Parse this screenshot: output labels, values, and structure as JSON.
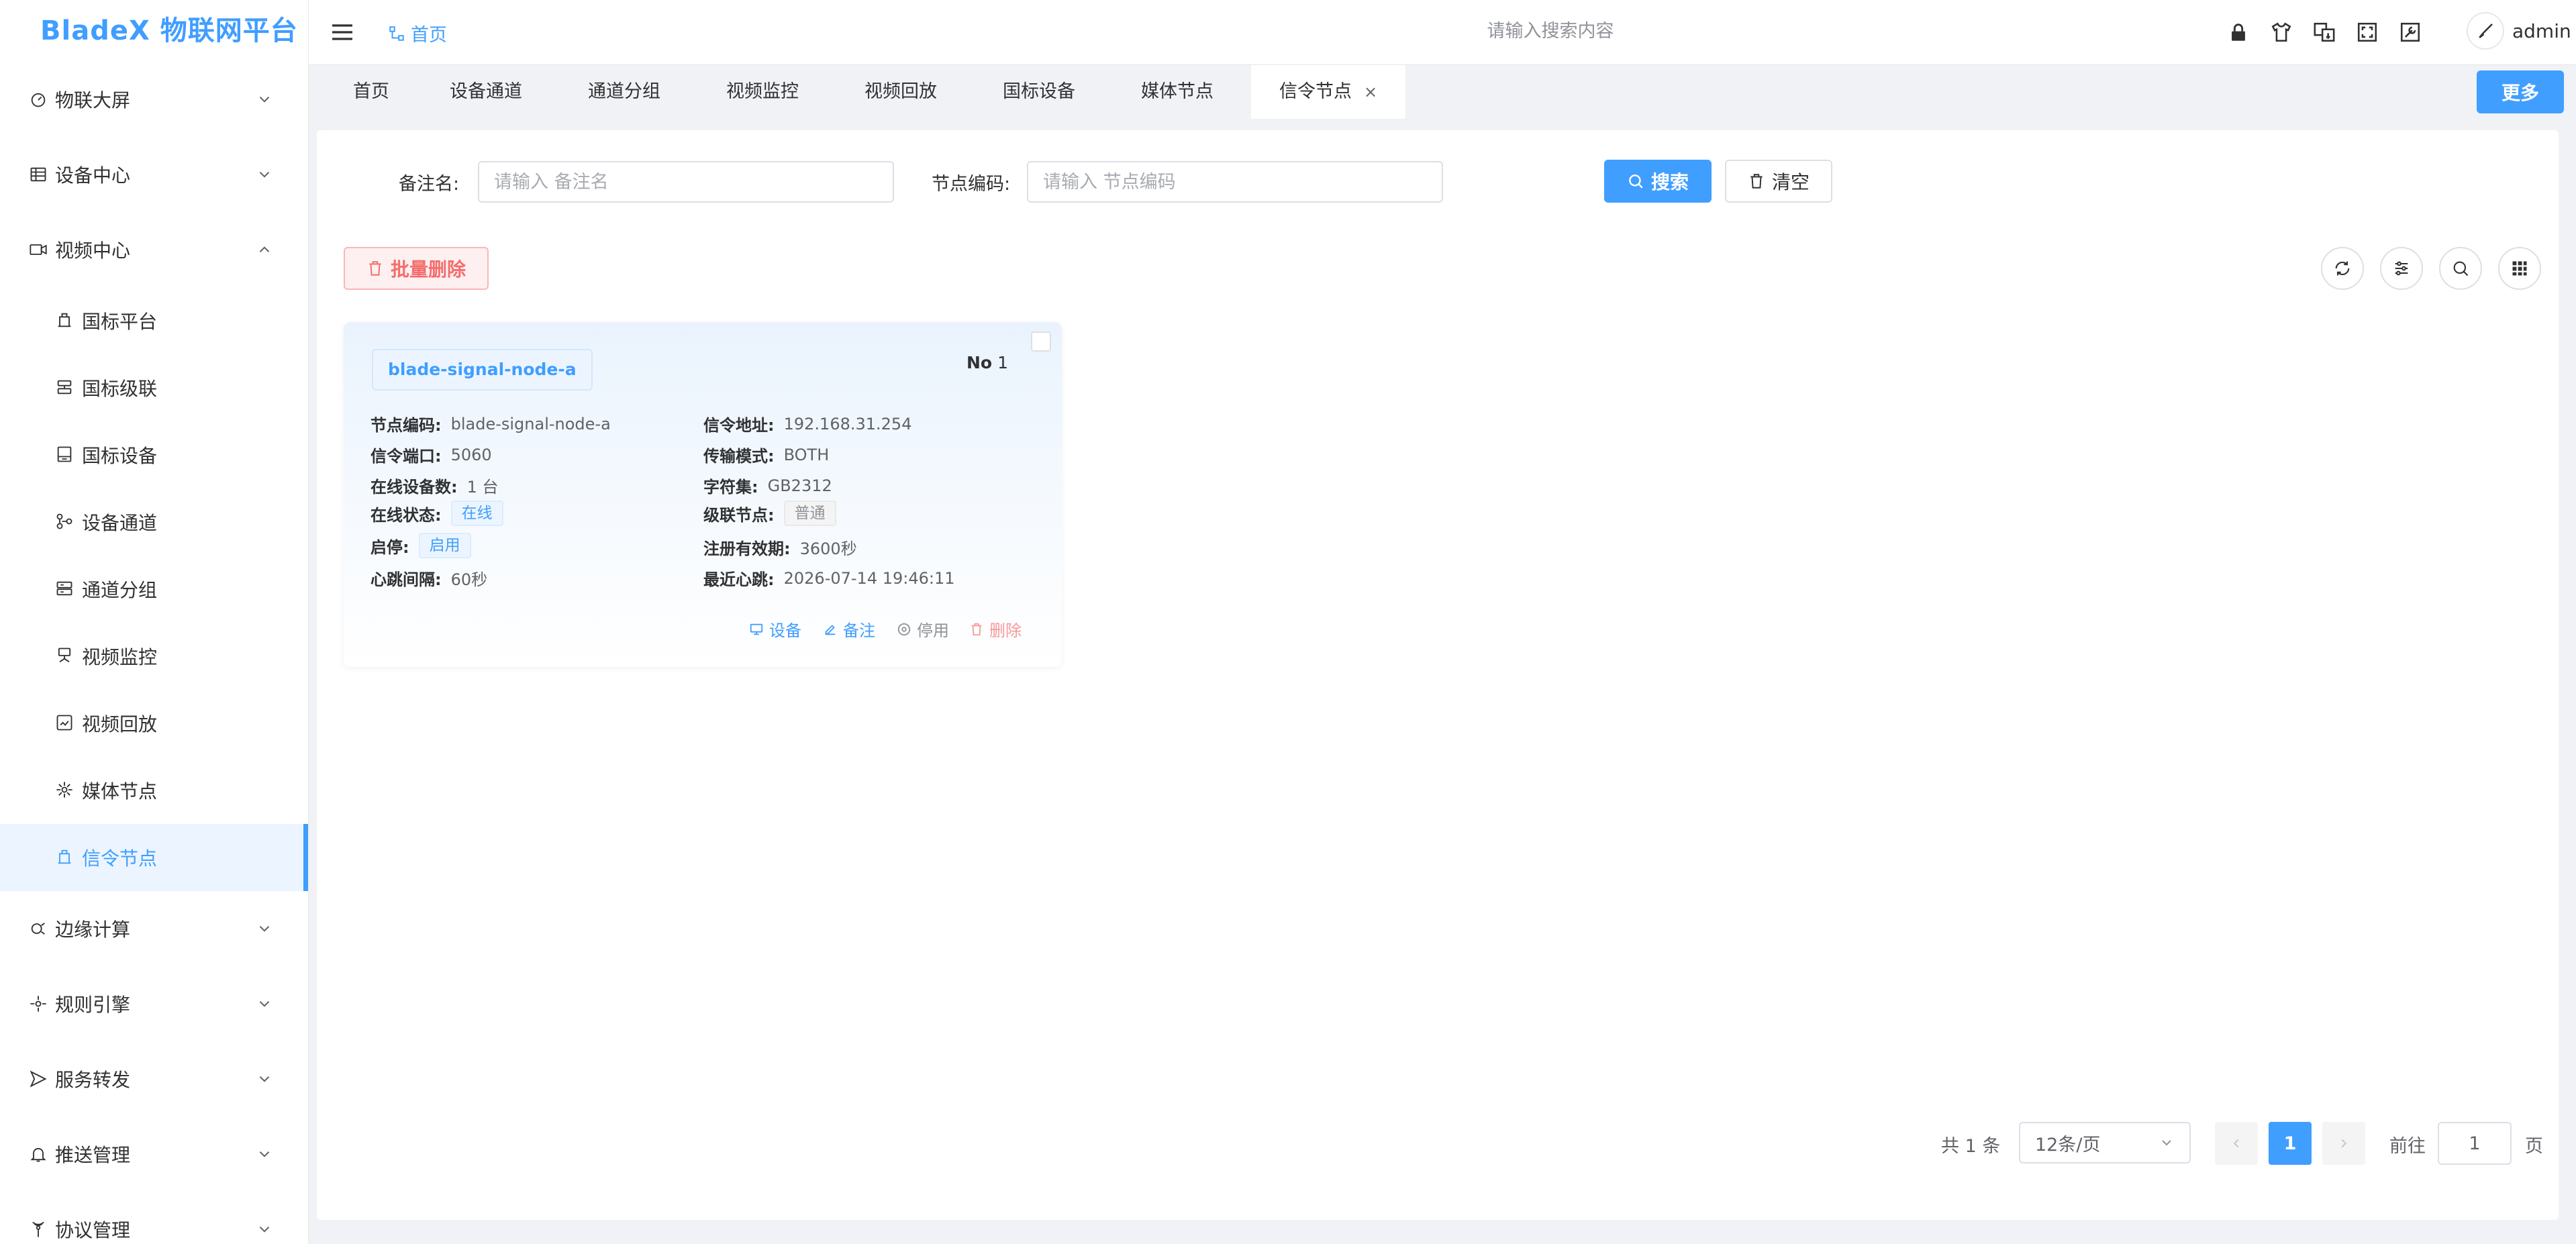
{
  "app": {
    "title": "BladeX 物联网平台"
  },
  "sidebar": {
    "items": [
      {
        "label": "物联大屏",
        "icon": "dashboard-icon",
        "expanded": false
      },
      {
        "label": "设备中心",
        "icon": "device-center-icon",
        "expanded": false
      },
      {
        "label": "视频中心",
        "icon": "video-camera-icon",
        "expanded": true
      },
      {
        "label": "边缘计算",
        "icon": "edge-compute-icon",
        "expanded": false
      },
      {
        "label": "规则引擎",
        "icon": "rule-engine-icon",
        "expanded": false
      },
      {
        "label": "服务转发",
        "icon": "send-icon",
        "expanded": false
      },
      {
        "label": "推送管理",
        "icon": "bell-icon",
        "expanded": false
      },
      {
        "label": "协议管理",
        "icon": "antenna-icon",
        "expanded": false
      }
    ],
    "video_sub": [
      {
        "label": "国标平台",
        "icon": "platform-icon"
      },
      {
        "label": "国标级联",
        "icon": "cascade-icon"
      },
      {
        "label": "国标设备",
        "icon": "device-icon"
      },
      {
        "label": "设备通道",
        "icon": "channel-icon"
      },
      {
        "label": "通道分组",
        "icon": "group-icon"
      },
      {
        "label": "视频监控",
        "icon": "monitor-icon"
      },
      {
        "label": "视频回放",
        "icon": "playback-icon"
      },
      {
        "label": "媒体节点",
        "icon": "media-node-icon"
      },
      {
        "label": "信令节点",
        "icon": "signal-node-icon",
        "active": true
      }
    ]
  },
  "header": {
    "breadcrumb": "首页",
    "search_placeholder": "请输入搜索内容",
    "user": "admin"
  },
  "tabs": {
    "items": [
      "首页",
      "设备通道",
      "通道分组",
      "视频监控",
      "视频回放",
      "国标设备",
      "媒体节点",
      "信令节点"
    ],
    "active_index": 7,
    "close_glyph": "×",
    "more_label": "更多"
  },
  "filters": {
    "remark_label": "备注名:",
    "remark_placeholder": "请输入 备注名",
    "code_label": "节点编码:",
    "code_placeholder": "请输入 节点编码",
    "search_label": "搜索",
    "clear_label": "清空"
  },
  "toolbar": {
    "batch_delete_label": "批量删除"
  },
  "card": {
    "name": "blade-signal-node-a",
    "no_label": "No",
    "no_value": "1",
    "fields": {
      "code_k": "节点编码:",
      "code_v": "blade-signal-node-a",
      "addr_k": "信令地址:",
      "addr_v": "192.168.31.254",
      "port_k": "信令端口:",
      "port_v": "5060",
      "mode_k": "传输模式:",
      "mode_v": "BOTH",
      "online_k": "在线设备数:",
      "online_v": "1 台",
      "charset_k": "字符集:",
      "charset_v": "GB2312",
      "status_k": "在线状态:",
      "status_v": "在线",
      "cascade_k": "级联节点:",
      "cascade_v": "普通",
      "enable_k": "启停:",
      "enable_v": "启用",
      "expire_k": "注册有效期:",
      "expire_v": "3600秒",
      "heartbeat_k": "心跳间隔:",
      "heartbeat_v": "60秒",
      "last_k": "最近心跳:",
      "last_v": "2026-07-14 19:46:11"
    },
    "actions": {
      "device": "设备",
      "remark": "备注",
      "disable": "停用",
      "delete": "删除"
    }
  },
  "pagination": {
    "total": "共 1 条",
    "page_size": "12条/页",
    "current": "1",
    "goto_label": "前往",
    "goto_value": "1",
    "page_suffix": "页"
  },
  "colors": {
    "primary": "#409eff",
    "danger": "#f56c6c"
  }
}
